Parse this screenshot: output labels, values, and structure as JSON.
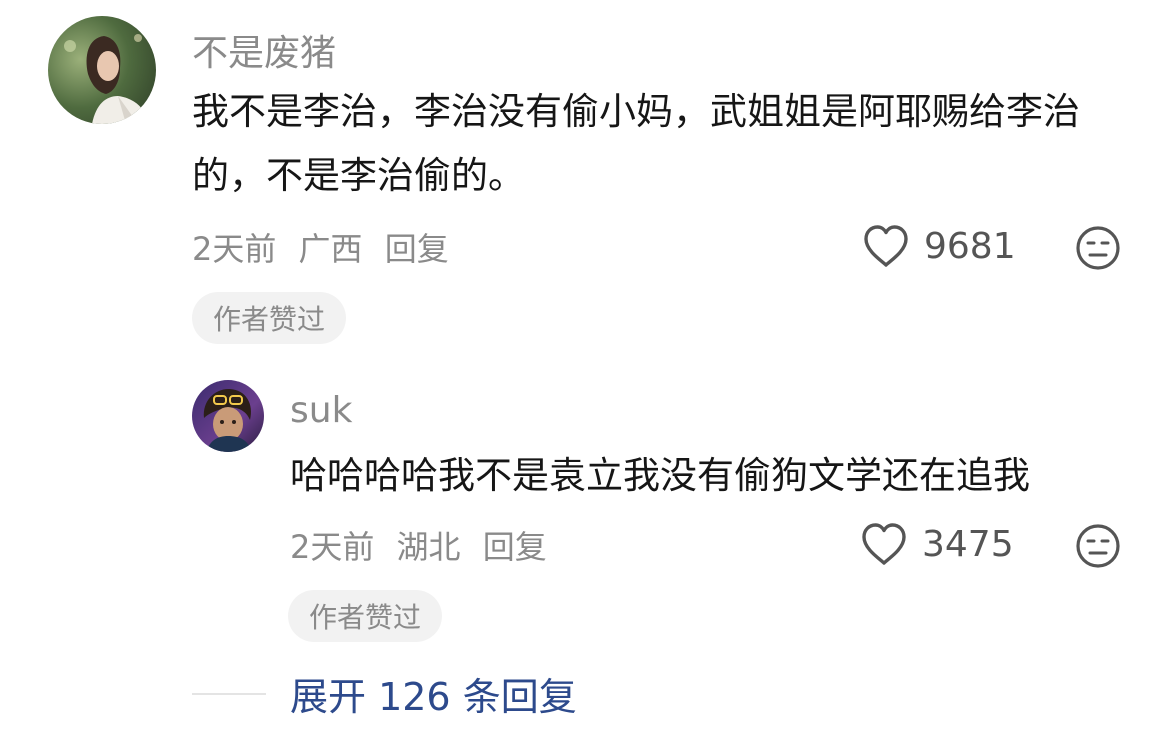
{
  "comments": [
    {
      "username": "不是废猪",
      "text": "我不是李治，李治没有偷小妈，武姐姐是阿耶赐给李治的，不是李治偷的。",
      "time": "2天前",
      "location": "广西",
      "reply_label": "回复",
      "likes": "9681",
      "badge": "作者赞过"
    },
    {
      "username": "suk",
      "text": "哈哈哈哈我不是袁立我没有偷狗文学还在追我",
      "time": "2天前",
      "location": "湖北",
      "reply_label": "回复",
      "likes": "3475",
      "badge": "作者赞过"
    }
  ],
  "expand_label": "展开 126 条回复",
  "icons": {
    "like": "heart-outline-icon",
    "dislike": "neutral-face-icon"
  },
  "colors": {
    "link": "#2d4a8c",
    "muted": "#8a8a8a",
    "badge_bg": "#f2f2f2"
  }
}
